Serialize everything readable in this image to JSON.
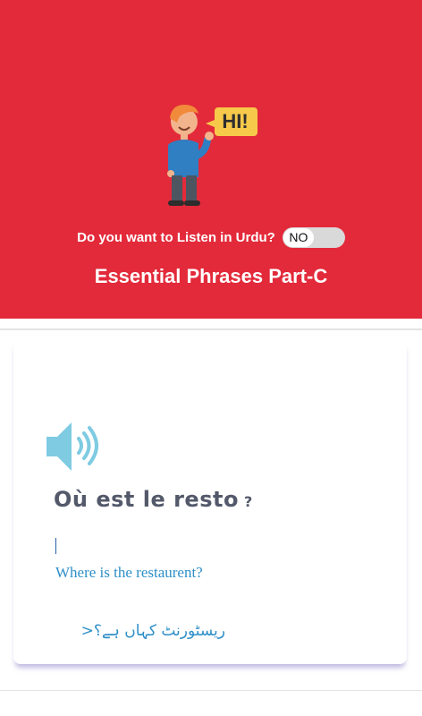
{
  "header": {
    "listen_prompt": "Do you want to Listen in Urdu?",
    "toggle_label": "NO",
    "title": "Essential Phrases Part-C",
    "bubble_text": "HI!"
  },
  "card": {
    "phrase_french": "Où est le resto",
    "question_mark": "?",
    "phrase_english": "Where is the restaurent?",
    "phrase_urdu": "ریسٹورنٹ کہاں ہے؟<"
  },
  "icons": {
    "mascot": "waving-man-icon",
    "speaker": "speaker-icon"
  },
  "colors": {
    "header_bg": "#e32a3a",
    "accent_blue": "#2e8fc8",
    "speaker_blue": "#7ecbe2",
    "toggle_off": "#d9d9d9"
  }
}
